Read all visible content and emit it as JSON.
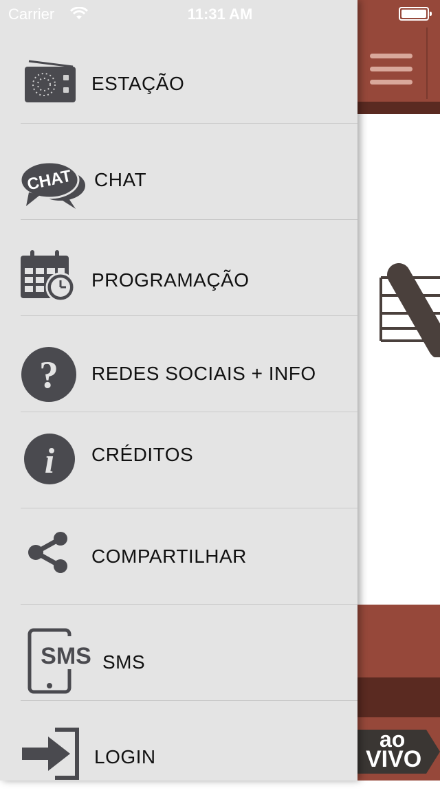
{
  "status": {
    "carrier": "Carrier",
    "time": "11:31 AM"
  },
  "menu": {
    "items": [
      {
        "label": "ESTAÇÃO",
        "icon": "radio-icon"
      },
      {
        "label": "CHAT",
        "icon": "chat-bubbles-icon",
        "icon_text": "CHAT"
      },
      {
        "label": "PROGRAMAÇÃO",
        "icon": "calendar-clock-icon"
      },
      {
        "label": "REDES SOCIAIS + INFO",
        "icon": "question-icon",
        "icon_text": "?"
      },
      {
        "label": "CRÉDITOS",
        "icon": "info-icon",
        "icon_text": "i"
      },
      {
        "label": "COMPARTILHAR",
        "icon": "share-icon"
      },
      {
        "label": "SMS",
        "icon": "sms-phone-icon",
        "icon_text": "SMS"
      },
      {
        "label": "LOGIN",
        "icon": "login-icon"
      }
    ]
  },
  "app": {
    "live_badge_line1": "ao",
    "live_badge_line2": "VIVO"
  },
  "colors": {
    "drawer_bg": "#e4e4e4",
    "brand": "#96483a",
    "brand_dark": "#5a2a21",
    "icon_dark": "#4a4a4f"
  }
}
